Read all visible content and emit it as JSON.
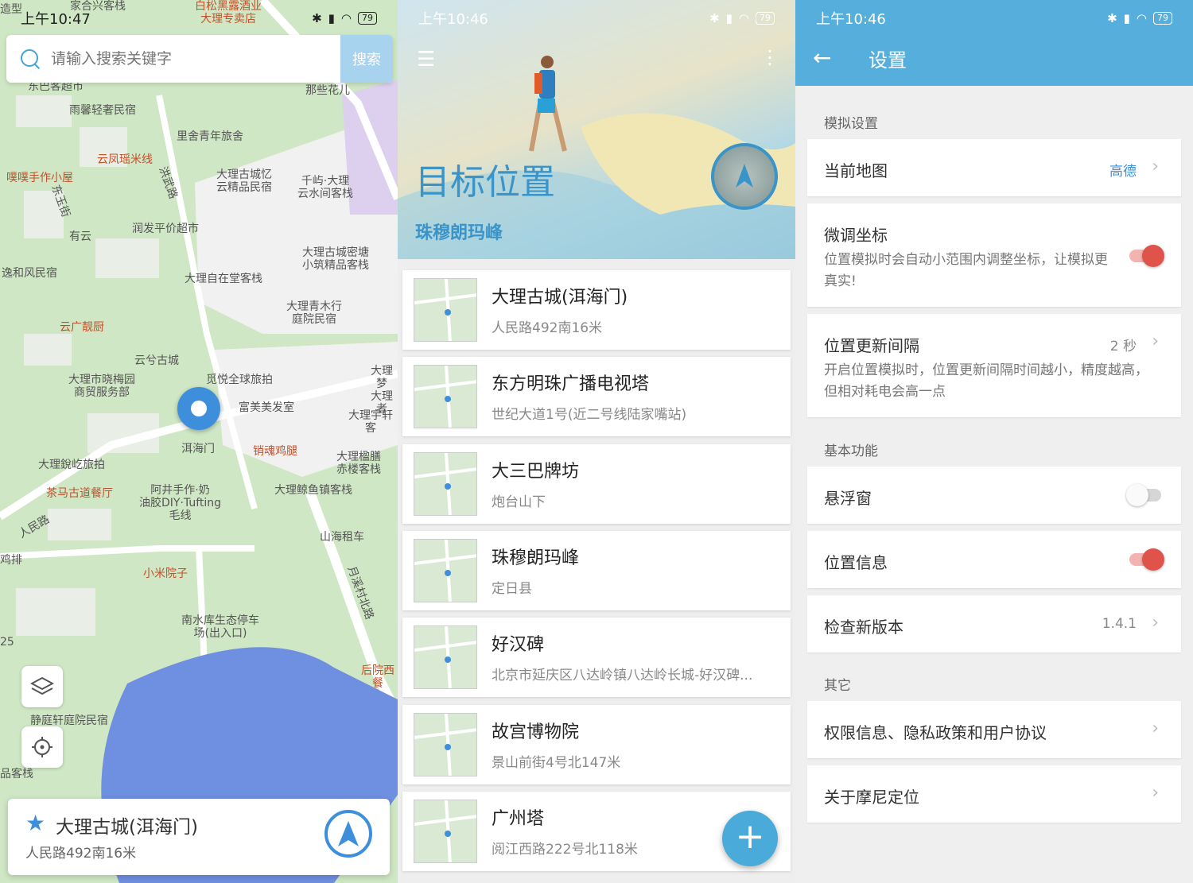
{
  "map_screen": {
    "status": {
      "time": "上午10:47",
      "battery": "79"
    },
    "search": {
      "placeholder": "请输入搜索关键字",
      "button": "搜索"
    },
    "pois": [
      "东巴客超市",
      "雨馨轻奢民宿",
      "里舍青年旅舍",
      "那些花儿",
      "云凤瑶米线",
      "噗噗手作小屋",
      "大理古城忆\n云精品民宿",
      "千屿·大理\n云水间客栈",
      "洪武路",
      "东玉街",
      "有云",
      "润发平价超市",
      "逸和风民宿",
      "大理古城密塘\n小筑精品客栈",
      "大理自在堂客栈",
      "大理青木行\n庭院民宿",
      "云广靓厨",
      "云兮古城",
      "大理市晓梅园\n商贸服务部",
      "觅悦全球旅拍",
      "大理梦\n大理者",
      "富美美发室",
      "大理宇轩客",
      "洱海门",
      "销魂鸡腿",
      "大理楹膳\n赤楼客栈",
      "大理銳屹旅拍",
      "茶马古道餐厅",
      "阿井手作·奶\n油胶DIY·Tufting\n毛线",
      "大理鲸鱼镇客栈",
      "人民路",
      "山海租车",
      "鸡排",
      "小米院子",
      "月溪村北路",
      "南水库生态停车\n场(出入口)",
      "后院西餐",
      "静庭轩庭院民宿",
      "品客栈",
      "25",
      "白松黑露酒业\n大理专卖店",
      "家合兴客栈",
      "造型"
    ],
    "selected": {
      "name": "大理古城(洱海门)",
      "address": "人民路492南16米"
    }
  },
  "list_screen": {
    "status": {
      "time": "上午10:46",
      "battery": "79"
    },
    "header": {
      "title": "目标位置",
      "subtitle": "珠穆朗玛峰"
    },
    "places": [
      {
        "name": "大理古城(洱海门)",
        "address": "人民路492南16米"
      },
      {
        "name": "东方明珠广播电视塔",
        "address": "世纪大道1号(近二号线陆家嘴站)"
      },
      {
        "name": "大三巴牌坊",
        "address": "炮台山下"
      },
      {
        "name": "珠穆朗玛峰",
        "address": "定日县"
      },
      {
        "name": "好汉碑",
        "address": "北京市延庆区八达岭镇八达岭长城-好汉碑..."
      },
      {
        "name": "故宫博物院",
        "address": "景山前街4号北147米"
      },
      {
        "name": "广州塔",
        "address": "阅江西路222号北118米"
      }
    ],
    "fab": "+"
  },
  "settings_screen": {
    "status": {
      "time": "上午10:46",
      "battery": "79"
    },
    "title": "设置",
    "sections": {
      "sim": "模拟设置",
      "basic": "基本功能",
      "other": "其它"
    },
    "rows": {
      "current_map": {
        "label": "当前地图",
        "value": "高德"
      },
      "fine_tune": {
        "label": "微调坐标",
        "desc": "位置模拟时会自动小范围内调整坐标，让模拟更真实!",
        "on": true
      },
      "update_interval": {
        "label": "位置更新间隔",
        "value": "2 秒",
        "desc": "开启位置模拟时，位置更新间隔时间越小，精度越高，但相对耗电会高一点"
      },
      "floating_window": {
        "label": "悬浮窗",
        "on": false
      },
      "location_info": {
        "label": "位置信息",
        "on": true
      },
      "check_version": {
        "label": "检查新版本",
        "value": "1.4.1"
      },
      "permissions": {
        "label": "权限信息、隐私政策和用户协议"
      },
      "about": {
        "label": "关于摩尼定位"
      }
    }
  },
  "colors": {
    "accent": "#55aedb",
    "toggle_on": "#e0534a",
    "map_green": "#cfe7c4",
    "map_water": "#6f8fe0"
  }
}
